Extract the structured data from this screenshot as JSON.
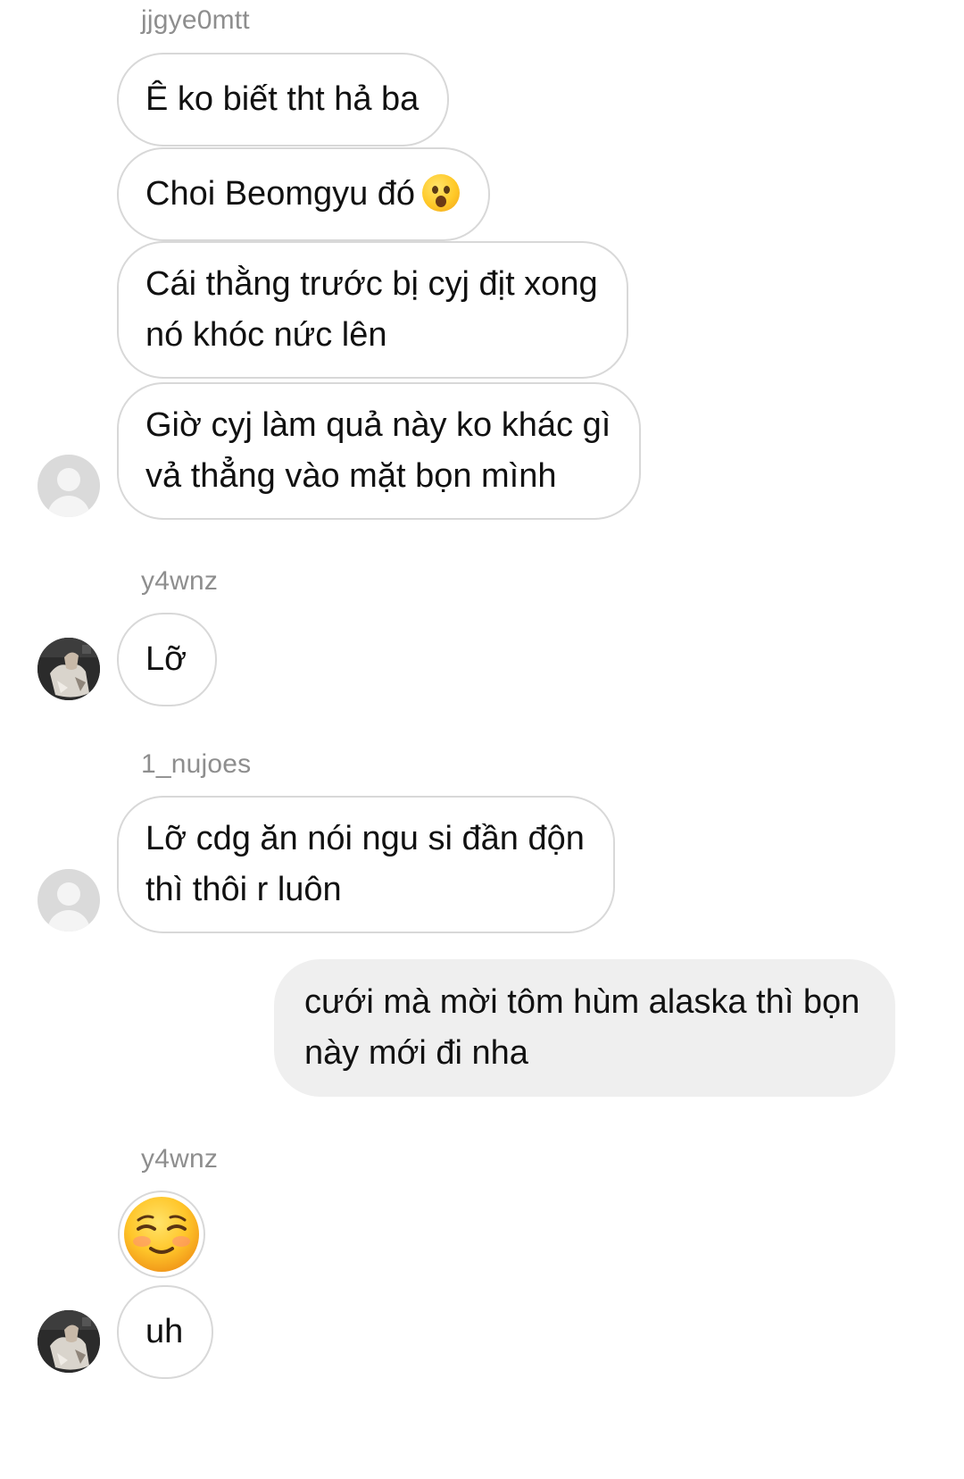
{
  "messages": {
    "group1": {
      "username": "jjgye0mtt",
      "bubbles": [
        {
          "lines": [
            "Ê ko biết tht hả ba"
          ]
        },
        {
          "lines": [
            "Choi Beomgyu đó"
          ],
          "emoji": "astonished-face"
        },
        {
          "lines": [
            "Cái thằng trước bị cyj địt xong",
            "nó khóc nức lên"
          ]
        },
        {
          "lines": [
            "Giờ cyj làm quả này ko khác gì",
            "vả thẳng vào mặt bọn mình"
          ]
        }
      ],
      "avatar": "default-avatar"
    },
    "group2": {
      "username": "y4wnz",
      "bubbles": [
        {
          "lines": [
            "Lỡ"
          ]
        }
      ],
      "avatar": "profile-photo"
    },
    "group3": {
      "username": "1_nujoes",
      "bubbles": [
        {
          "lines": [
            "Lỡ cdg ăn nói ngu si đần độn",
            "thì thôi r luôn"
          ]
        }
      ],
      "avatar": "default-avatar"
    },
    "outgoing": {
      "lines": [
        "cưới mà mời tôm hùm alaska thì bọn",
        "này mới đi nha"
      ]
    },
    "group4": {
      "username": "y4wnz",
      "emoji": "smiling-face-emoji",
      "bubbles": [
        {
          "lines": [
            "uh"
          ]
        }
      ],
      "avatar": "profile-photo"
    }
  },
  "colors": {
    "incoming_border": "#d8d8d8",
    "outgoing_bg": "#efefef",
    "username_text": "#8e8e8e"
  }
}
